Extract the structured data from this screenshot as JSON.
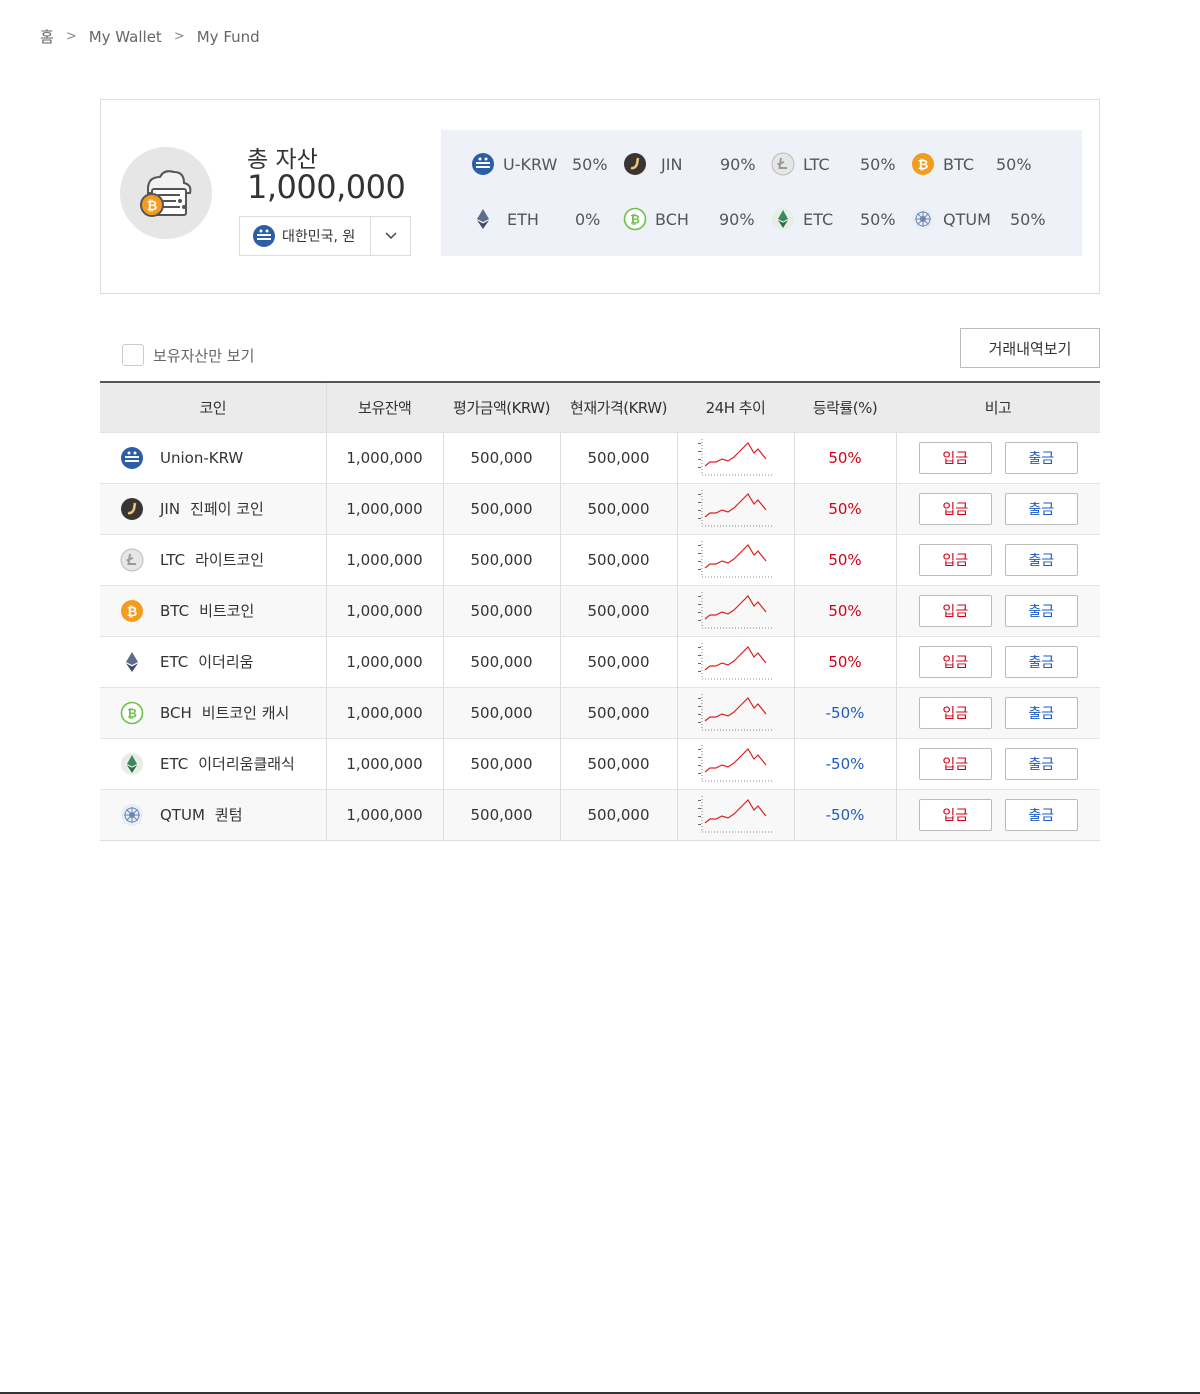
{
  "breadcrumb": {
    "home": "홈",
    "sep": ">",
    "wallet": "My Wallet",
    "fund": "My Fund"
  },
  "summary": {
    "icon": "crypto-wallet-icon",
    "label": "총 자산",
    "amount": "1,000,000",
    "currency": "대한민국, 원",
    "allocation": [
      {
        "name": "U-KRW",
        "percent": "50%",
        "icon": "ukrw-icon"
      },
      {
        "name": "JIN",
        "percent": "90%",
        "icon": "jin-icon"
      },
      {
        "name": "LTC",
        "percent": "50%",
        "icon": "ltc-icon"
      },
      {
        "name": "BTC",
        "percent": "50%",
        "icon": "btc-icon"
      },
      {
        "name": "ETH",
        "percent": "0%",
        "icon": "eth-icon"
      },
      {
        "name": "BCH",
        "percent": "90%",
        "icon": "bch-icon"
      },
      {
        "name": "ETC",
        "percent": "50%",
        "icon": "etc-icon"
      },
      {
        "name": "QTUM",
        "percent": "50%",
        "icon": "qtum-icon"
      }
    ]
  },
  "filter": {
    "checkbox_label": "보유자산만 보기"
  },
  "history_button": "거래내역보기",
  "table": {
    "headers": [
      "코인",
      "보유잔액",
      "평가금액(KRW)",
      "현재가격(KRW)",
      "24H 추이",
      "등락률(%)",
      "비고"
    ],
    "deposit_label": "입금",
    "withdraw_label": "출금",
    "rows": [
      {
        "symbol": "Union-KRW",
        "korean": "",
        "icon": "ukrw-icon",
        "balance": "1,000,000",
        "valuation": "500,000",
        "price": "500,000",
        "change": "50%",
        "direction": "up"
      },
      {
        "symbol": "JIN",
        "korean": "진페이 코인",
        "icon": "jin-icon",
        "balance": "1,000,000",
        "valuation": "500,000",
        "price": "500,000",
        "change": "50%",
        "direction": "up"
      },
      {
        "symbol": "LTC",
        "korean": "라이트코인",
        "icon": "ltc-icon",
        "balance": "1,000,000",
        "valuation": "500,000",
        "price": "500,000",
        "change": "50%",
        "direction": "up"
      },
      {
        "symbol": "BTC",
        "korean": "비트코인",
        "icon": "btc-icon",
        "balance": "1,000,000",
        "valuation": "500,000",
        "price": "500,000",
        "change": "50%",
        "direction": "up"
      },
      {
        "symbol": "ETC",
        "korean": "이더리움",
        "icon": "eth-icon",
        "balance": "1,000,000",
        "valuation": "500,000",
        "price": "500,000",
        "change": "50%",
        "direction": "up"
      },
      {
        "symbol": "BCH",
        "korean": "비트코인 캐시",
        "icon": "bch-icon",
        "balance": "1,000,000",
        "valuation": "500,000",
        "price": "500,000",
        "change": "-50%",
        "direction": "down"
      },
      {
        "symbol": "ETC",
        "korean": "이더리움클래식",
        "icon": "etc-icon",
        "balance": "1,000,000",
        "valuation": "500,000",
        "price": "500,000",
        "change": "-50%",
        "direction": "down"
      },
      {
        "symbol": "QTUM",
        "korean": "퀀텀",
        "icon": "qtum-icon",
        "balance": "1,000,000",
        "valuation": "500,000",
        "price": "500,000",
        "change": "-50%",
        "direction": "down"
      }
    ]
  },
  "colors": {
    "positive": "#d0021b",
    "negative": "#1a5bc4",
    "sparkline": "#e02020",
    "allocation_bg": "#eef2f8"
  }
}
